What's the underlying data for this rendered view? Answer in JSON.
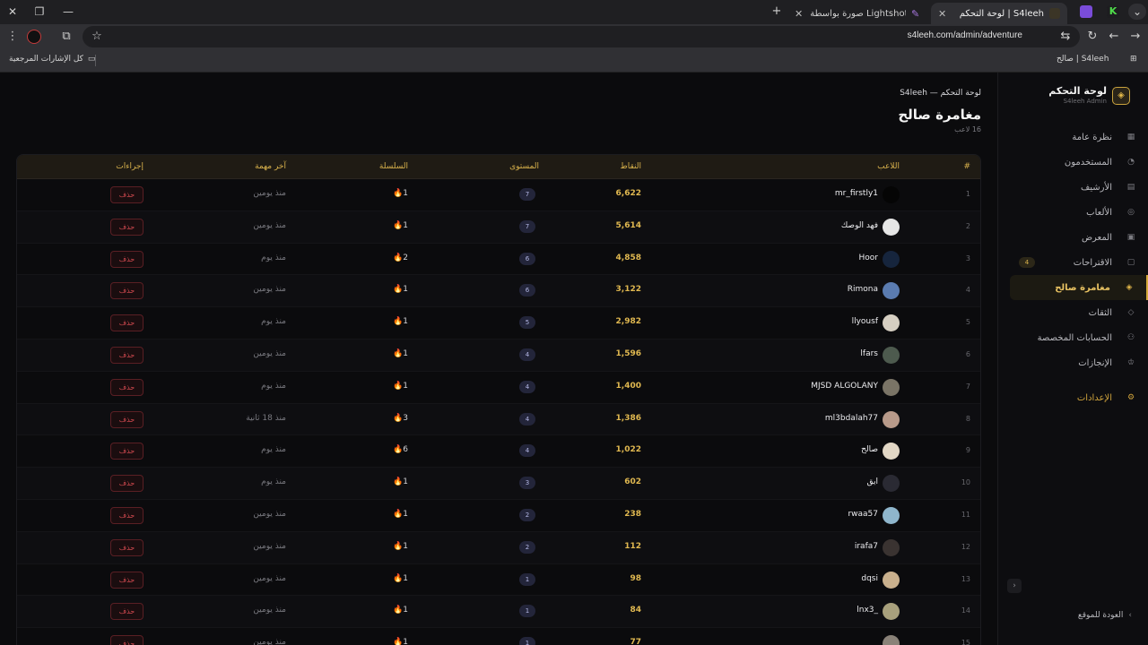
{
  "browser": {
    "tabs": [
      {
        "title": "لوحة التحكم | S4leeh",
        "active": true
      },
      {
        "title": "صورة بواسطة Lightshot",
        "active": false
      }
    ],
    "new_tab": "+",
    "url": "s4leeh.com/admin/adventure",
    "bookmarks": {
      "all_label": "كل الإشارات المرجعية",
      "site_label": "صالح | S4leeh"
    }
  },
  "sidebar": {
    "brand_title": "لوحة التحكم",
    "brand_sub": "S4leeh Admin",
    "items": [
      {
        "label": "نظرة عامة",
        "icon": "grid-icon"
      },
      {
        "label": "المستخدمون",
        "icon": "user-icon"
      },
      {
        "label": "الأرشيف",
        "icon": "archive-icon"
      },
      {
        "label": "الألعاب",
        "icon": "gamepad-icon"
      },
      {
        "label": "المعرض",
        "icon": "image-icon"
      },
      {
        "label": "الاقتراحات",
        "icon": "chat-icon",
        "badge": "4"
      },
      {
        "label": "مغامرة صالح",
        "icon": "layers-icon",
        "active": true
      },
      {
        "label": "الثقات",
        "icon": "tag-icon"
      },
      {
        "label": "الحسابات المخصصة",
        "icon": "user-plus-icon"
      },
      {
        "label": "الإنجازات",
        "icon": "trophy-icon"
      }
    ],
    "settings": "الإعدادات",
    "back": "العودة للموقع"
  },
  "main": {
    "breadcrumb": "لوحة التحكم — S4leeh",
    "title": "مغامرة صالح",
    "subtitle": "16 لاعب",
    "columns": {
      "idx": "#",
      "player": "اللاعب",
      "points": "النقاط",
      "level": "المستوى",
      "streak": "السلسلة",
      "last": "آخر مهمة",
      "actions": "إجراءات"
    },
    "delete_label": "حذف",
    "rows": [
      {
        "idx": "1",
        "name": "mr_firstly1",
        "points": "6,622",
        "level": "7",
        "streak": "1",
        "last": "منذ يومين",
        "avatar": "#050505"
      },
      {
        "idx": "2",
        "name": "فهد الوصك",
        "points": "5,614",
        "level": "7",
        "streak": "1",
        "last": "منذ يومين",
        "avatar": "#e6e6e6"
      },
      {
        "idx": "3",
        "name": "Hoor",
        "points": "4,858",
        "level": "6",
        "streak": "2",
        "last": "منذ يوم",
        "avatar": "#16253d"
      },
      {
        "idx": "4",
        "name": "Rimona",
        "points": "3,122",
        "level": "6",
        "streak": "1",
        "last": "منذ يومين",
        "avatar": "#5a7bb0"
      },
      {
        "idx": "5",
        "name": "llyousf",
        "points": "2,982",
        "level": "5",
        "streak": "1",
        "last": "منذ يوم",
        "avatar": "#d6cfc2"
      },
      {
        "idx": "6",
        "name": "lfars",
        "points": "1,596",
        "level": "4",
        "streak": "1",
        "last": "منذ يومين",
        "avatar": "#4d5a4e"
      },
      {
        "idx": "7",
        "name": "MJSD ALGOLANY",
        "points": "1,400",
        "level": "4",
        "streak": "1",
        "last": "منذ يوم",
        "avatar": "#7a7466"
      },
      {
        "idx": "8",
        "name": "ml3bdalah77",
        "points": "1,386",
        "level": "4",
        "streak": "3",
        "last": "منذ 18 ثانية",
        "avatar": "#b89a8a"
      },
      {
        "idx": "9",
        "name": "صالح",
        "points": "1,022",
        "level": "4",
        "streak": "6",
        "last": "منذ يوم",
        "avatar": "#e2d7c5"
      },
      {
        "idx": "10",
        "name": "ايق",
        "points": "602",
        "level": "3",
        "streak": "1",
        "last": "منذ يوم",
        "avatar": "#2a2a33"
      },
      {
        "idx": "11",
        "name": "rwaa57",
        "points": "238",
        "level": "2",
        "streak": "1",
        "last": "منذ يومين",
        "avatar": "#8fb6cc"
      },
      {
        "idx": "12",
        "name": "irafa7",
        "points": "112",
        "level": "2",
        "streak": "1",
        "last": "منذ يومين",
        "avatar": "#3a3331"
      },
      {
        "idx": "13",
        "name": "dqsi",
        "points": "98",
        "level": "1",
        "streak": "1",
        "last": "منذ يومين",
        "avatar": "#c9b08d"
      },
      {
        "idx": "14",
        "name": "_lnx3",
        "points": "84",
        "level": "1",
        "streak": "1",
        "last": "منذ يومين",
        "avatar": "#a8a07c"
      },
      {
        "idx": "15",
        "name": "",
        "points": "77",
        "level": "1",
        "streak": "1",
        "last": "منذ يومين",
        "avatar": "#8a8278"
      }
    ]
  },
  "colors": {
    "accent": "#d4a93a",
    "danger": "#d0494f",
    "level_badge": "#23253a"
  }
}
